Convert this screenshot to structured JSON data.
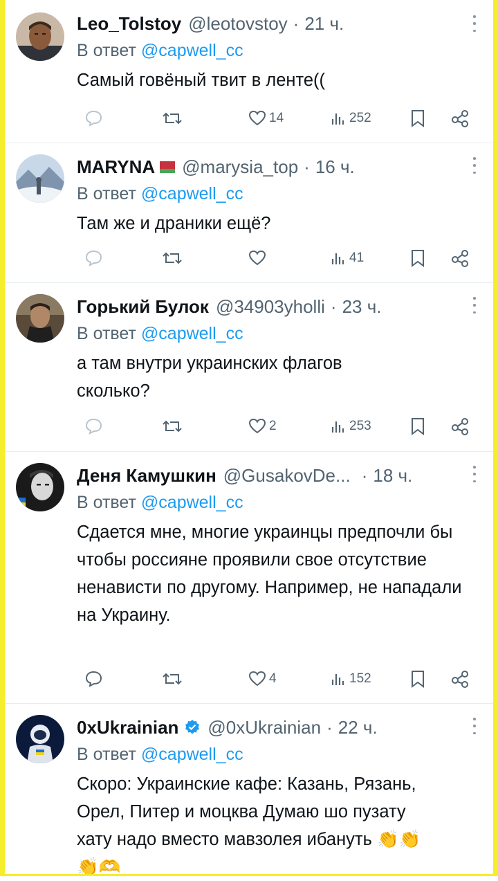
{
  "colors": {
    "accent": "#1d9bf0",
    "muted": "#536471",
    "frame": "#f5ee2a",
    "divider": "#e6ecf0"
  },
  "tweets": [
    {
      "name": "Leo_Tolstoy",
      "handle": "@leotovstoy",
      "time": "21 ч.",
      "reply_prefix": "В ответ",
      "mention": "@capwell_cc",
      "text": "Самый говёный твит в ленте((",
      "likes": "14",
      "views": "252",
      "avatar_icon": "man-portrait-avatar"
    },
    {
      "name": "MARYNA",
      "handle": "@marysia_top",
      "time": "16 ч.",
      "reply_prefix": "В ответ",
      "mention": "@capwell_cc",
      "text": "Там же и драники ещё?",
      "likes": "",
      "views": "41",
      "avatar_icon": "winter-landscape-avatar",
      "flag_icon": "belarus-flag-icon"
    },
    {
      "name": "Горький Булок",
      "handle": "@34903yholli",
      "time": "23 ч.",
      "reply_prefix": "В ответ",
      "mention": "@capwell_cc",
      "text": "а там внутри украинских флагов сколько?",
      "likes": "2",
      "views": "253",
      "avatar_icon": "game-character-avatar"
    },
    {
      "name": "Деня Камушкин",
      "handle": "@GusakovDe...",
      "time": "18 ч.",
      "reply_prefix": "В ответ",
      "mention": "@capwell_cc",
      "text": "Сдается мне, многие украинцы предпочли бы чтобы россияне проявили свое отсутствие ненависти по другому. Например, не нападали на Украину.",
      "likes": "4",
      "views": "152",
      "avatar_icon": "bw-portrait-avatar"
    },
    {
      "name": "0xUkrainian",
      "handle": "@0xUkrainian",
      "time": "22 ч.",
      "reply_prefix": "В ответ",
      "mention": "@capwell_cc",
      "text": "Скоро: Украинские кафе: Казань, Рязань, Орел, Питер и моцква Думаю шо пузату хату надо вместо мавзолея ибануть 👏👏👏🫶",
      "likes": "",
      "views": "",
      "avatar_icon": "astronaut-avatar",
      "verified_icon": "verified-badge-icon"
    }
  ]
}
